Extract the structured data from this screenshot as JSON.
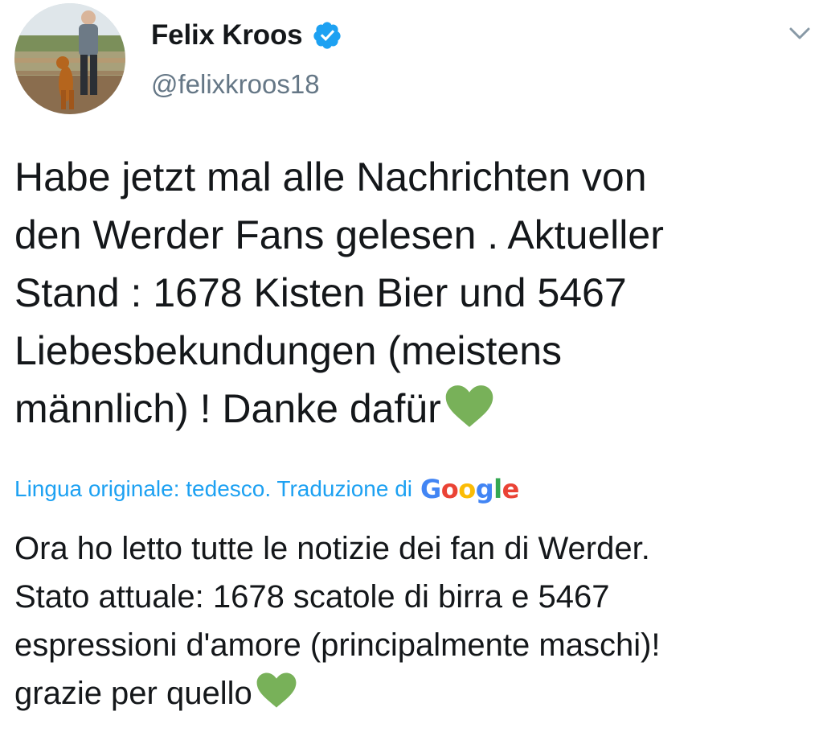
{
  "user": {
    "display_name": "Felix Kroos",
    "handle": "@felixkroos18",
    "verified": true,
    "avatar_icon": "profile-photo"
  },
  "tweet": {
    "text": "Habe jetzt mal alle Nachrichten von\nden Werder Fans gelesen . Aktueller\nStand : 1678 Kisten Bier und 5467\nLiebesbekundungen (meistens\nmännlich) ! Danke dafür",
    "emoji": "green-heart-icon"
  },
  "translation": {
    "label": "Lingua originale: tedesco. Traduzione di",
    "provider": [
      "G",
      "o",
      "o",
      "g",
      "l",
      "e"
    ],
    "text": "Ora ho letto tutte le notizie dei fan di Werder.\nStato attuale: 1678 scatole di birra e 5467\nespressioni d'amore (principalmente maschi)!\ngrazie per quello",
    "emoji": "green-heart-icon"
  },
  "colors": {
    "link_blue": "#1da1f2",
    "verified_blue": "#1da1f2",
    "heart_green": "#78b159",
    "secondary_text": "#657786",
    "google_blue": "#4285f4",
    "google_red": "#ea4335",
    "google_yellow": "#fbbc05",
    "google_green": "#34a853"
  }
}
